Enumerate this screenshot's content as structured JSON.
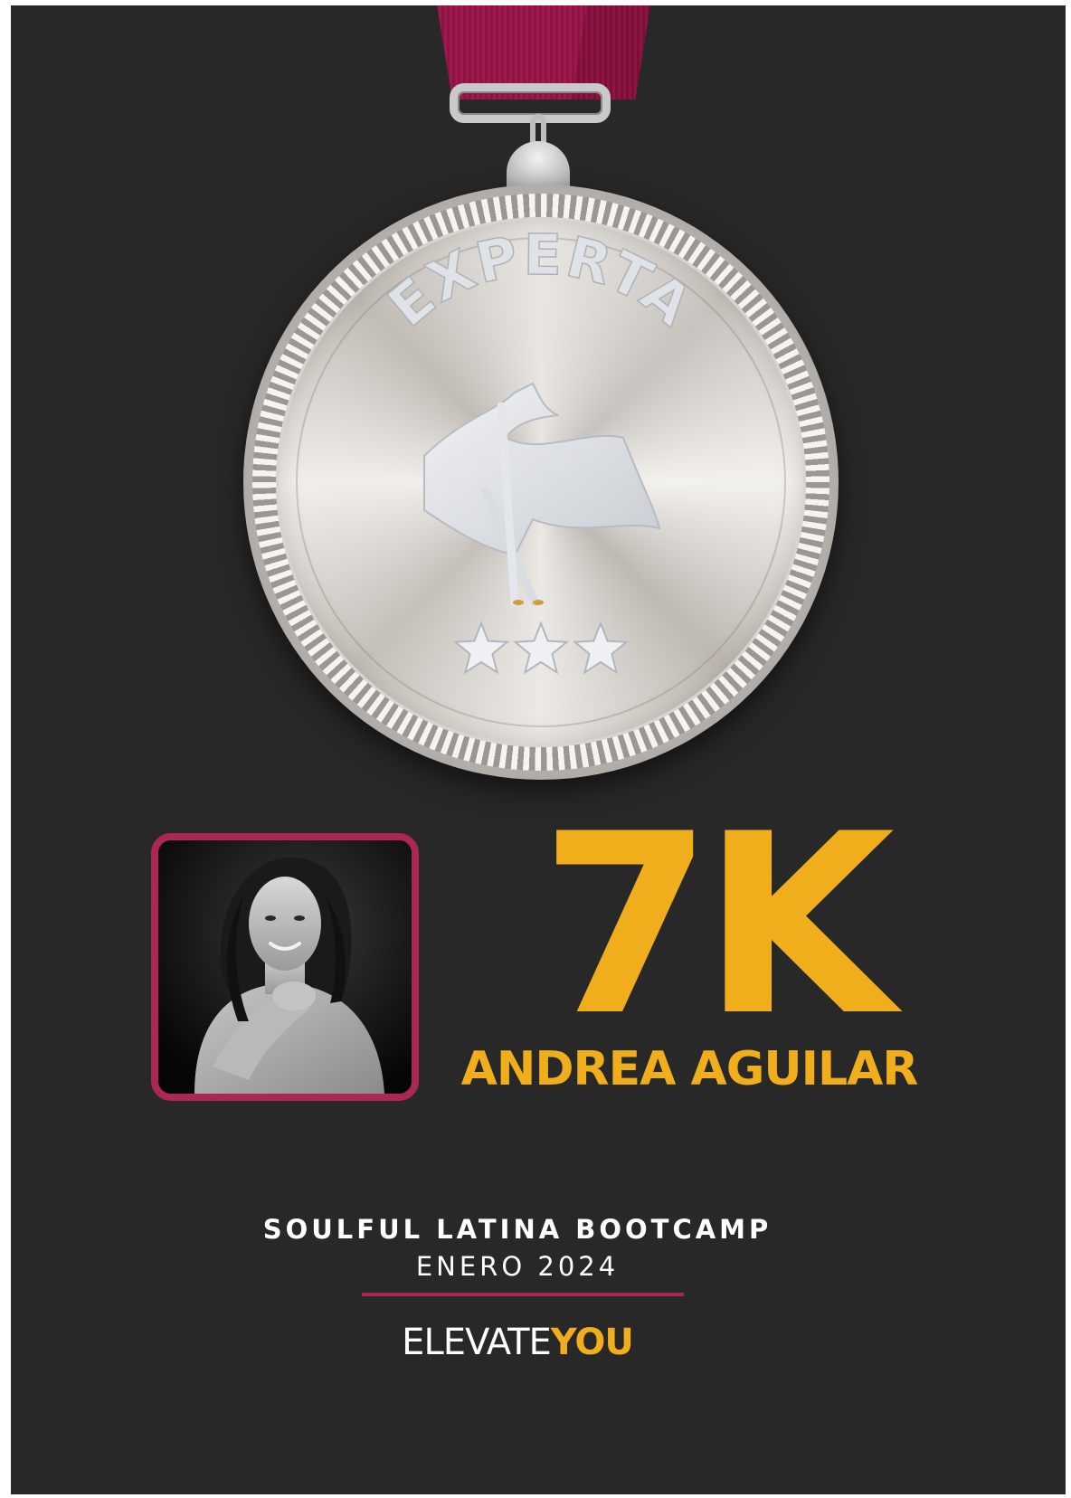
{
  "medal": {
    "title": "EXPERTA",
    "stars": 3,
    "ribbon_color": "#951747",
    "icon": "flag-icon"
  },
  "profile": {
    "photo_alt": "portrait-photo",
    "frame_color": "#ad2755"
  },
  "headline": {
    "distance": "7K",
    "name": "ANDREA AGUILAR",
    "accent_color": "#f0ae1c"
  },
  "event": {
    "name": "SOULFUL LATINA BOOTCAMP",
    "date": "ENERO 2024"
  },
  "brand": {
    "prefix": "ELEVATE",
    "suffix": "YOU"
  }
}
